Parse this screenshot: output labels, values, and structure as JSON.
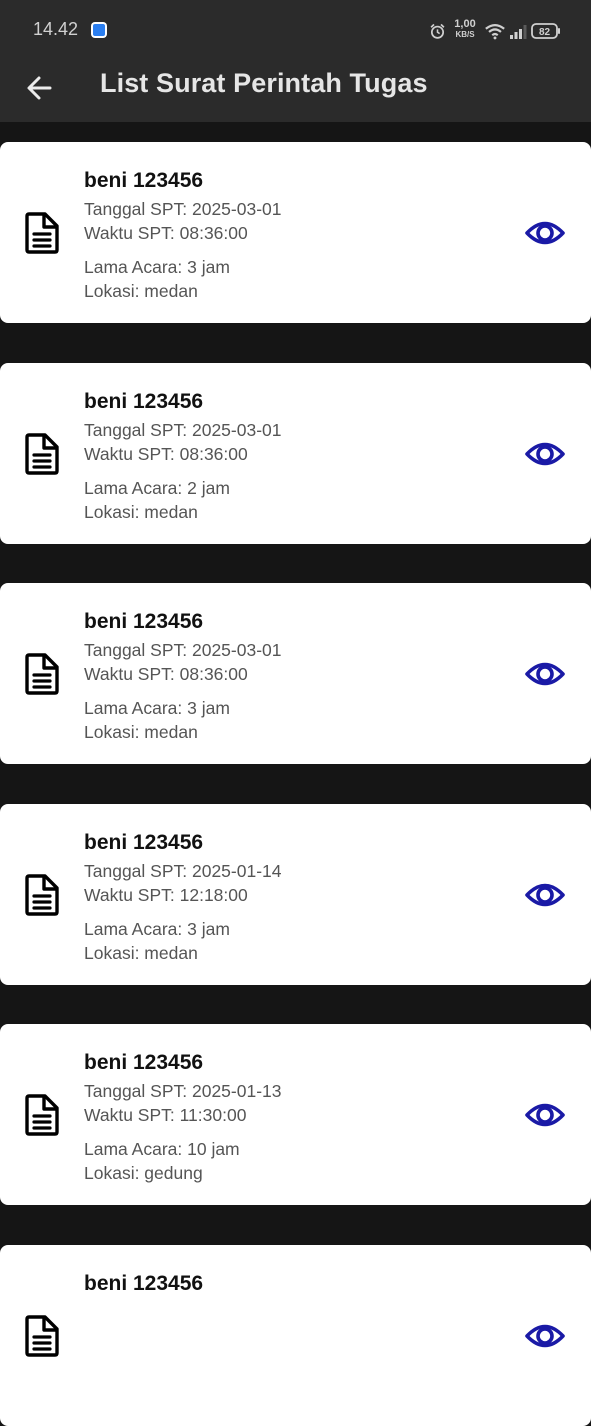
{
  "status_bar": {
    "time": "14.42",
    "net_speed_value": "1,00",
    "net_speed_unit": "KB/S",
    "battery": "82",
    "icons": [
      "app-icon",
      "alarm-icon",
      "wifi-icon",
      "signal-icon",
      "battery-icon"
    ]
  },
  "app_bar": {
    "title": "List Surat Perintah Tugas",
    "back_icon": "arrow-left-icon"
  },
  "colors": {
    "background": "#151515",
    "app_bar": "#2b2b2b",
    "card": "#ffffff",
    "accent": "#1a1aa6",
    "secondary_text": "#555555"
  },
  "items": [
    {
      "title": "beni 123456",
      "date": "Tanggal SPT: 2025-03-01",
      "time": "Waktu SPT: 08:36:00",
      "duration": "Lama Acara: 3 jam",
      "location": "Lokasi: medan"
    },
    {
      "title": "beni 123456",
      "date": "Tanggal SPT: 2025-03-01",
      "time": "Waktu SPT: 08:36:00",
      "duration": "Lama Acara: 2 jam",
      "location": "Lokasi: medan"
    },
    {
      "title": "beni 123456",
      "date": "Tanggal SPT: 2025-03-01",
      "time": "Waktu SPT: 08:36:00",
      "duration": "Lama Acara: 3 jam",
      "location": "Lokasi: medan"
    },
    {
      "title": "beni 123456",
      "date": "Tanggal SPT: 2025-01-14",
      "time": "Waktu SPT: 12:18:00",
      "duration": "Lama Acara: 3 jam",
      "location": "Lokasi: medan"
    },
    {
      "title": "beni 123456",
      "date": "Tanggal SPT: 2025-01-13",
      "time": "Waktu SPT: 11:30:00",
      "duration": "Lama Acara: 10 jam",
      "location": "Lokasi: gedung"
    },
    {
      "title": "beni 123456"
    }
  ]
}
